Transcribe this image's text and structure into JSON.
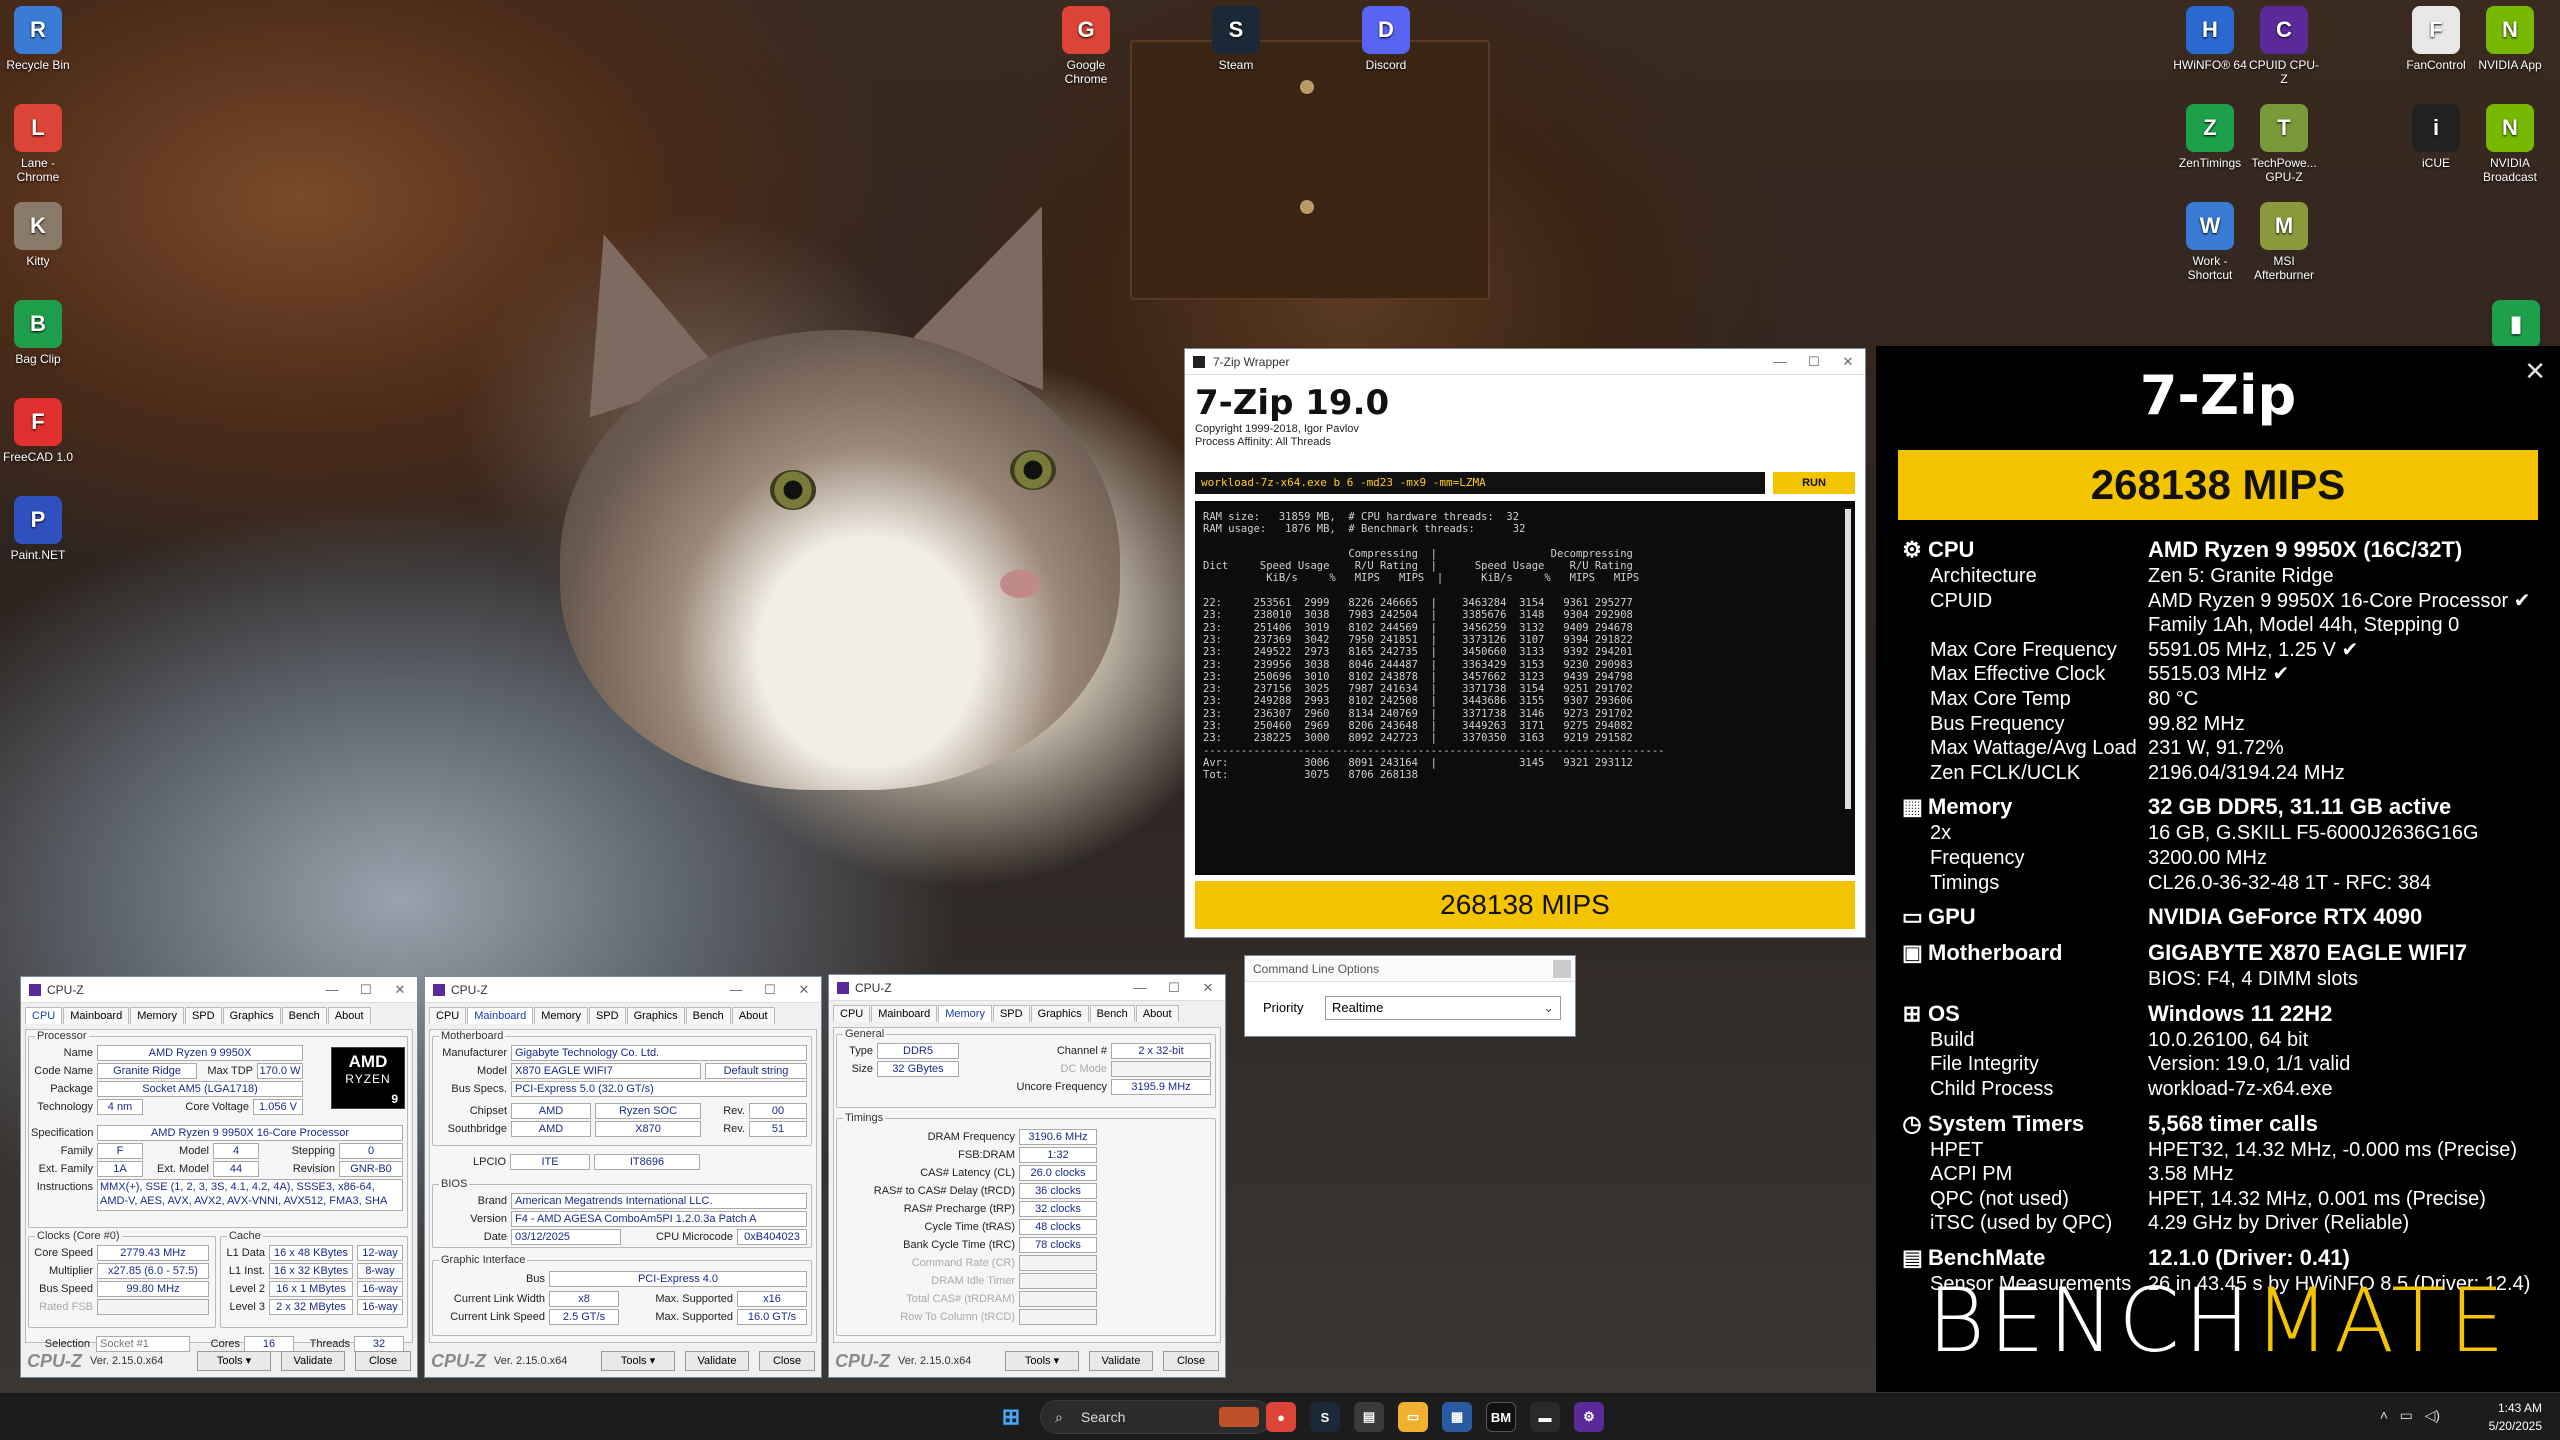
{
  "desktop": {
    "left_icons": [
      {
        "label": "Recycle Bin",
        "icon": "recycle-bin-icon",
        "color": "#3a7bd5"
      },
      {
        "label": "Lane - Chrome",
        "icon": "chrome-icon",
        "color": "#db4437"
      },
      {
        "label": "Kitty",
        "icon": "cat-image-icon",
        "color": "#8a7a6a"
      },
      {
        "label": "Bag Clip",
        "icon": "bag-clip-icon",
        "color": "#1e9e4a"
      },
      {
        "label": "FreeCAD 1.0",
        "icon": "freecad-icon",
        "color": "#e03030"
      },
      {
        "label": "Paint.NET",
        "icon": "paintnet-icon",
        "color": "#3050c0"
      }
    ],
    "top_icons": [
      {
        "label": "Google Chrome",
        "icon": "chrome-icon",
        "color": "#db4437"
      },
      {
        "label": "Steam",
        "icon": "steam-icon",
        "color": "#1b2838"
      },
      {
        "label": "Discord",
        "icon": "discord-icon",
        "color": "#5865f2"
      }
    ],
    "right_icons": [
      {
        "label": "HWiNFO® 64",
        "icon": "hwinfo-icon",
        "color": "#2a6ad0"
      },
      {
        "label": "CPUID CPU-Z",
        "icon": "cpuz-icon",
        "color": "#5a2a9a"
      },
      {
        "label": "FanControl",
        "icon": "fan-icon",
        "color": "#e8e8e8"
      },
      {
        "label": "NVIDIA App",
        "icon": "nvidia-icon",
        "color": "#76b900"
      },
      {
        "label": "ZenTimings",
        "icon": "zentimings-icon",
        "color": "#1ea04a"
      },
      {
        "label": "TechPowe... GPU-Z",
        "icon": "gpuz-icon",
        "color": "#7a9a3a"
      },
      {
        "label": "iCUE",
        "icon": "icue-icon",
        "color": "#222"
      },
      {
        "label": "NVIDIA Broadcast",
        "icon": "nvidia-broadcast-icon",
        "color": "#76b900"
      },
      {
        "label": "Work - Shortcut",
        "icon": "work-shortcut-icon",
        "color": "#3a7bd5"
      },
      {
        "label": "MSI Afterburner",
        "icon": "afterburner-icon",
        "color": "#8a9a3a"
      }
    ]
  },
  "zip": {
    "window_title": "7-Zip Wrapper",
    "heading": "7-Zip 19.0",
    "copyright": "Copyright 1999-2018, Igor Pavlov",
    "affinity": "Process Affinity: All Threads",
    "command": "workload-7z-x64.exe b 6 -md23 -mx9 -mm=LZMA",
    "run_label": "RUN",
    "console": "RAM size:   31859 MB,  # CPU hardware threads:  32\nRAM usage:   1876 MB,  # Benchmark threads:      32\n\n                       Compressing  |                  Decompressing\nDict     Speed Usage    R/U Rating  |      Speed Usage    R/U Rating\n          KiB/s     %   MIPS   MIPS  |      KiB/s     %   MIPS   MIPS\n\n22:     253561  2999   8226 246665  |    3463284  3154   9361 295277\n23:     238010  3038   7983 242504  |    3385676  3148   9304 292908\n23:     251406  3019   8102 244569  |    3456259  3132   9409 294678\n23:     237369  3042   7950 241851  |    3373126  3107   9394 291822\n23:     249522  2973   8165 242735  |    3450660  3133   9392 294201\n23:     239956  3038   8046 244487  |    3363429  3153   9230 290983\n23:     250696  3010   8102 243878  |    3457662  3123   9439 294798\n23:     237156  3025   7987 241634  |    3371738  3154   9251 291702\n23:     249288  2993   8102 242508  |    3443686  3155   9307 293606\n23:     236307  2960   8134 240769  |    3371738  3146   9273 291702\n23:     250460  2969   8206 243648  |    3449263  3171   9275 294082\n23:     238225  3000   8092 242723  |    3370350  3163   9219 291582\n-------------------------------------------------------------------------\nAvr:            3006   8091 243164  |             3145   9321 293112\nTot:            3075   8706 268138",
    "result": "268138 MIPS"
  },
  "clo": {
    "title": "Command Line Options",
    "priority_label": "Priority",
    "priority_value": "Realtime"
  },
  "cpuz_common": {
    "title": "CPU-Z",
    "tabs": [
      "CPU",
      "Mainboard",
      "Memory",
      "SPD",
      "Graphics",
      "Bench",
      "About"
    ],
    "logo": "CPU-Z",
    "version": "Ver. 2.15.0.x64",
    "tools": "Tools",
    "validate": "Validate",
    "close": "Close"
  },
  "cpuz1": {
    "processor_group": "Processor",
    "name_l": "Name",
    "name": "AMD Ryzen 9 9950X",
    "codename_l": "Code Name",
    "codename": "Granite Ridge",
    "maxtdp_l": "Max TDP",
    "maxtdp": "170.0 W",
    "package_l": "Package",
    "package": "Socket AM5 (LGA1718)",
    "tech_l": "Technology",
    "tech": "4 nm",
    "cv_l": "Core Voltage",
    "cv": "1.056 V",
    "spec_l": "Specification",
    "spec": "AMD Ryzen 9 9950X 16-Core Processor",
    "family_l": "Family",
    "family": "F",
    "model_l": "Model",
    "model": "4",
    "stepping_l": "Stepping",
    "stepping": "0",
    "extfam_l": "Ext. Family",
    "extfam": "1A",
    "extmodel_l": "Ext. Model",
    "extmodel": "44",
    "rev_l": "Revision",
    "rev": "GNR-B0",
    "instr_l": "Instructions",
    "instr": "MMX(+), SSE (1, 2, 3, 3S, 4.1, 4.2, 4A), SSSE3, x86-64, AMD-V, AES, AVX, AVX2, AVX-VNNI, AVX512, FMA3, SHA",
    "clocks_group": "Clocks (Core #0)",
    "cs_l": "Core Speed",
    "cs": "2779.43 MHz",
    "mult_l": "Multiplier",
    "mult": "x27.85 (6.0 - 57.5)",
    "bus_l": "Bus Speed",
    "bus": "99.80 MHz",
    "fsb_l": "Rated FSB",
    "fsb": "",
    "cache_group": "Cache",
    "l1d_l": "L1 Data",
    "l1d": "16 x 48 KBytes",
    "l1d_w": "12-way",
    "l1i_l": "L1 Inst.",
    "l1i": "16 x 32 KBytes",
    "l1i_w": "8-way",
    "l2_l": "Level 2",
    "l2": "16 x 1 MBytes",
    "l2_w": "16-way",
    "l3_l": "Level 3",
    "l3": "2 x 32 MBytes",
    "l3_w": "16-way",
    "sel_l": "Selection",
    "sel": "Socket #1",
    "cores_l": "Cores",
    "cores": "16",
    "threads_l": "Threads",
    "threads": "32",
    "badge_top": "AMD",
    "badge_mid": "RYZEN",
    "badge_num": "9"
  },
  "cpuz2": {
    "mb_group": "Motherboard",
    "manu_l": "Manufacturer",
    "manu": "Gigabyte Technology Co. Ltd.",
    "model_l": "Model",
    "model": "X870 EAGLE WIFI7",
    "model_b": "Default string",
    "busspec_l": "Bus Specs.",
    "busspec": "PCI-Express 5.0 (32.0 GT/s)",
    "chip_l": "Chipset",
    "chip_a": "AMD",
    "chip_b": "Ryzen SOC",
    "chip_rev_l": "Rev.",
    "chip_rev": "00",
    "sb_l": "Southbridge",
    "sb_a": "AMD",
    "sb_b": "X870",
    "sb_rev_l": "Rev.",
    "sb_rev": "51",
    "lpcio_l": "LPCIO",
    "lpcio_a": "ITE",
    "lpcio_b": "IT8696",
    "bios_group": "BIOS",
    "brand_l": "Brand",
    "brand": "American Megatrends International LLC.",
    "ver_l": "Version",
    "ver": "F4 - AMD AGESA ComboAm5PI 1.2.0.3a Patch A",
    "date_l": "Date",
    "date": "03/12/2025",
    "mc_l": "CPU Microcode",
    "mc": "0xB404023",
    "gi_group": "Graphic Interface",
    "gbus_l": "Bus",
    "gbus": "PCI-Express 4.0",
    "clw_l": "Current Link Width",
    "clw": "x8",
    "msw_l": "Max. Supported",
    "msw": "x16",
    "cls_l": "Current Link Speed",
    "cls": "2.5 GT/s",
    "mss_l": "Max. Supported",
    "mss": "16.0 GT/s"
  },
  "cpuz3": {
    "gen_group": "General",
    "type_l": "Type",
    "type": "DDR5",
    "ch_l": "Channel #",
    "ch": "2 x 32-bit",
    "size_l": "Size",
    "size": "32 GBytes",
    "dc_l": "DC Mode",
    "dc": "",
    "uf_l": "Uncore Frequency",
    "uf": "3195.9 MHz",
    "tim_group": "Timings",
    "rows": [
      {
        "l": "DRAM Frequency",
        "v": "3190.6 MHz"
      },
      {
        "l": "FSB:DRAM",
        "v": "1:32"
      },
      {
        "l": "CAS# Latency (CL)",
        "v": "26.0 clocks"
      },
      {
        "l": "RAS# to CAS# Delay (tRCD)",
        "v": "36 clocks"
      },
      {
        "l": "RAS# Precharge (tRP)",
        "v": "32 clocks"
      },
      {
        "l": "Cycle Time (tRAS)",
        "v": "48 clocks"
      },
      {
        "l": "Bank Cycle Time (tRC)",
        "v": "78 clocks"
      },
      {
        "l": "Command Rate (CR)",
        "v": ""
      },
      {
        "l": "DRAM Idle Timer",
        "v": ""
      },
      {
        "l": "Total CAS# (tRDRAM)",
        "v": ""
      },
      {
        "l": "Row To Column (tRCD)",
        "v": ""
      }
    ]
  },
  "bm": {
    "title": "7-Zip",
    "score": "268138 MIPS",
    "rows": [
      {
        "sec": true,
        "k": "CPU",
        "v": "AMD Ryzen 9 9950X (16C/32T)",
        "icon": "⚙"
      },
      {
        "k": "Architecture",
        "v": "Zen 5: Granite Ridge"
      },
      {
        "k": "CPUID",
        "v": "AMD Ryzen 9 9950X 16-Core Processor ✔"
      },
      {
        "k": "",
        "v": "Family 1Ah, Model 44h, Stepping 0"
      },
      {
        "k": "Max Core Frequency",
        "v": "5591.05 MHz, 1.25 V ✔"
      },
      {
        "k": "Max Effective Clock",
        "v": "5515.03 MHz ✔"
      },
      {
        "k": "Max Core Temp",
        "v": "80 °C"
      },
      {
        "k": "Bus Frequency",
        "v": "99.82 MHz"
      },
      {
        "k": "Max Wattage/Avg Load",
        "v": "231 W, 91.72%"
      },
      {
        "k": "Zen FCLK/UCLK",
        "v": "2196.04/3194.24 MHz"
      },
      {
        "sec": true,
        "k": "Memory",
        "v": "32 GB DDR5, 31.11 GB active",
        "icon": "▦"
      },
      {
        "k": "2x",
        "v": "16 GB, G.SKILL F5-6000J2636G16G"
      },
      {
        "k": "Frequency",
        "v": "3200.00 MHz"
      },
      {
        "k": "Timings",
        "v": "CL26.0-36-32-48 1T - RFC: 384"
      },
      {
        "sec": true,
        "k": "GPU",
        "v": "NVIDIA GeForce RTX 4090",
        "icon": "▭"
      },
      {
        "sec": true,
        "k": "Motherboard",
        "v": "GIGABYTE X870 EAGLE WIFI7",
        "icon": "▣"
      },
      {
        "k": "",
        "v": "BIOS: F4, 4 DIMM slots"
      },
      {
        "sec": true,
        "k": "OS",
        "v": "Windows 11 22H2",
        "icon": "⊞"
      },
      {
        "k": "Build",
        "v": "10.0.26100, 64 bit"
      },
      {
        "k": "File Integrity",
        "v": "Version: 19.0, 1/1 valid"
      },
      {
        "k": "Child Process",
        "v": "workload-7z-x64.exe"
      },
      {
        "sec": true,
        "k": "System Timers",
        "v": "5,568 timer calls",
        "icon": "◷"
      },
      {
        "k": "HPET",
        "v": "HPET32, 14.32 MHz, -0.000 ms (Precise)"
      },
      {
        "k": "ACPI PM",
        "v": "3.58 MHz"
      },
      {
        "k": "QPC (not used)",
        "v": "HPET, 14.32 MHz, 0.001 ms (Precise)"
      },
      {
        "k": "iTSC (used by QPC)",
        "v": "4.29 GHz by Driver (Reliable)"
      },
      {
        "sec": true,
        "k": "BenchMate",
        "v": "12.1.0 (Driver: 0.41)",
        "icon": "▤"
      },
      {
        "k": "Sensor Measurements",
        "v": "26 in 43.45 s by HWiNFO 8.5 (Driver: 12.4)"
      }
    ],
    "logo_a": "BENCH",
    "logo_b": "MATE"
  },
  "taskbar": {
    "search": "Search",
    "time": "1:43 AM",
    "date": "5/20/2025"
  }
}
